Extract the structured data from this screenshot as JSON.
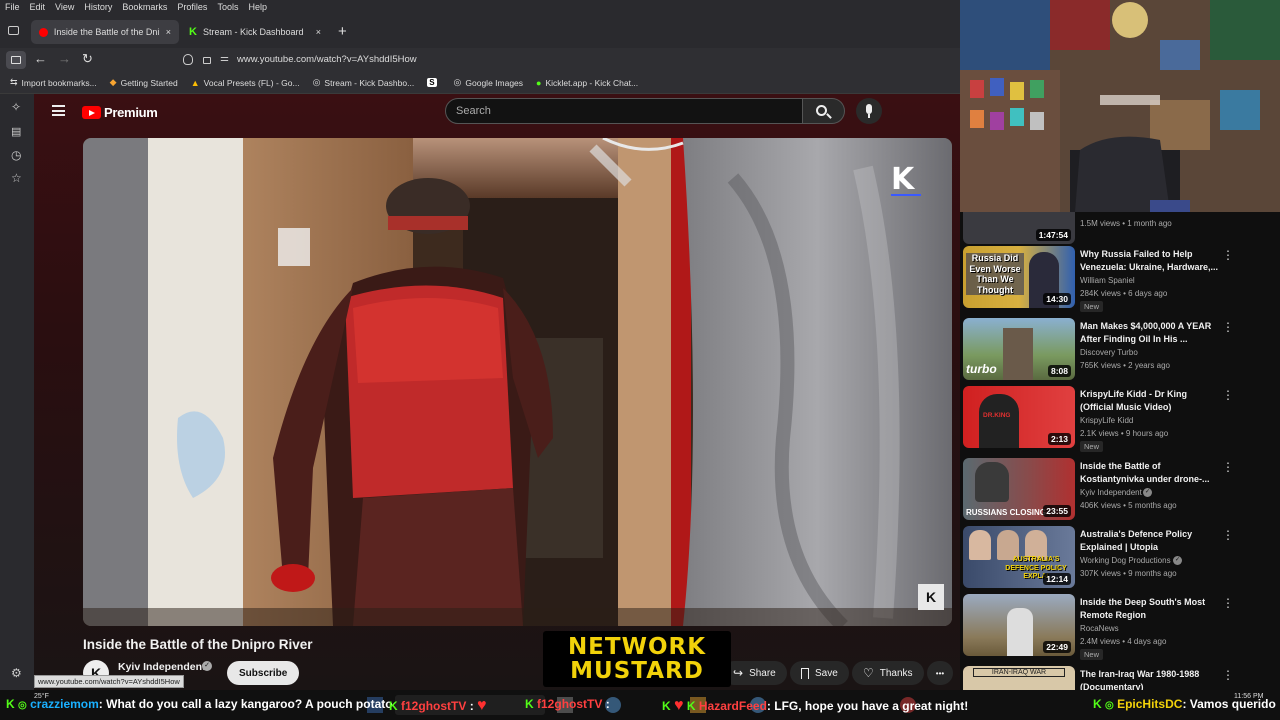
{
  "menubar": [
    "File",
    "Edit",
    "View",
    "History",
    "Bookmarks",
    "Profiles",
    "Tools",
    "Help"
  ],
  "tabs": [
    {
      "title": "Inside the Battle of the Dnipro R",
      "close": "×"
    },
    {
      "title": "Stream - Kick Dashboard",
      "close": "×"
    }
  ],
  "new_tab": "+",
  "url": "www.youtube.com/watch?v=AYshddI5How",
  "bookmarks": [
    "Import bookmarks...",
    "Getting Started",
    "Vocal Presets (FL) - Go...",
    "Stream - Kick Dashbo...",
    "",
    "Google Images",
    "Kicklet.app - Kick Chat..."
  ],
  "youtube": {
    "logo": "Premium",
    "search_placeholder": "Search",
    "video_title": "Inside the Battle of the Dnipro River",
    "channel": "Kyiv Independent",
    "channel_initial": "K",
    "subscribe": "Subscribe",
    "share": "Share",
    "save": "Save",
    "thanks": "Thanks",
    "more": "•••",
    "status_url": "www.youtube.com/watch?v=AYshddI5How",
    "watermark": "K",
    "watermark_small": "K"
  },
  "overlay_logo": [
    "NETWORK",
    "MUSTARD"
  ],
  "related": [
    {
      "title": "",
      "channel": "",
      "meta": "1.5M views • 1 month ago",
      "duration": "1:47:54",
      "new": ""
    },
    {
      "title": "Why Russia Failed to Help Venezuela: Ukraine, Hardware,...",
      "channel": "William Spaniel",
      "meta": "284K views • 6 days ago",
      "duration": "14:30",
      "new": "New",
      "thumb_text": "Russia Did Even Worse Than We Thought"
    },
    {
      "title": "Man Makes $4,000,000 A YEAR After Finding Oil In His ...",
      "channel": "Discovery Turbo",
      "meta": "765K views • 2 years ago",
      "duration": "8:08",
      "new": "",
      "thumb_text": "turbo"
    },
    {
      "title": "KrispyLife Kidd - Dr King (Official Music Video)",
      "channel": "KrispyLife Kidd",
      "meta": "2.1K views • 9 hours ago",
      "duration": "2:13",
      "new": "New",
      "thumb_text": "DR.KING"
    },
    {
      "title": "Inside the Battle of Kostiantynivka under drone-...",
      "channel": "Kyiv Independent",
      "meta": "406K views • 5 months ago",
      "duration": "23:55",
      "new": "",
      "thumb_text": "RUSSIANS CLOSING I"
    },
    {
      "title": "Australia's Defence Policy Explained | Utopia",
      "channel": "Working Dog Productions",
      "meta": "307K views • 9 months ago",
      "duration": "12:14",
      "new": "",
      "thumb_text": "AUSTRALIA'S DEFENCE POLICY EXPLAI"
    },
    {
      "title": "Inside the Deep South's Most Remote Region",
      "channel": "RocaNews",
      "meta": "2.4M views • 4 days ago",
      "duration": "22:49",
      "new": "New",
      "thumb_text": ""
    },
    {
      "title": "The Iran-Iraq War 1980-1988 (Documentary)",
      "channel": "",
      "meta": "",
      "duration": "",
      "new": "",
      "thumb_text": "IRAN-IRAQ WAR"
    }
  ],
  "chat": {
    "line1_user": "crazziemom",
    "line1_msg": ": What do you call a lazy kangaroo? A pouch potato",
    "line2_user": "f12ghostTV",
    "line3_user": "f12ghostTV",
    "line4_user": "HazardFeed",
    "line4_msg": ": LFG, hope you have a great night!",
    "line5_user": "EpicHitsDC",
    "line5_msg": ": Vamos querido"
  },
  "taskbar": {
    "weather": "25°F",
    "time": "11:56 PM"
  },
  "colors": {
    "yt_red": "#ff0000",
    "kick_green": "#53fc18",
    "mustard": "#f2d20a"
  }
}
